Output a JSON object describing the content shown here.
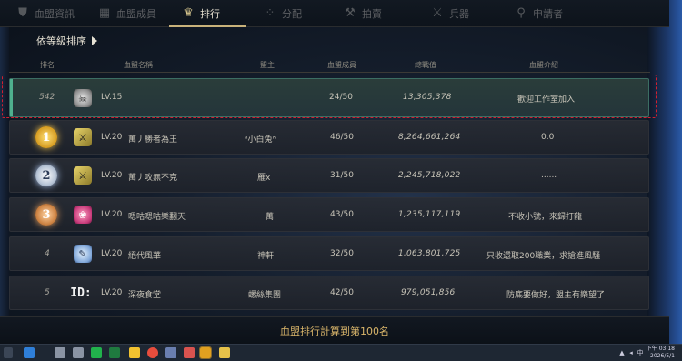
{
  "nav": {
    "tabs": [
      {
        "label": "血盟資訊",
        "icon": "shield-icon",
        "active": false
      },
      {
        "label": "血盟成員",
        "icon": "members-icon",
        "active": false
      },
      {
        "label": "排行",
        "icon": "ranking-icon",
        "active": true
      },
      {
        "label": "分配",
        "icon": "distribute-icon",
        "active": false
      },
      {
        "label": "拍賣",
        "icon": "gavel-icon",
        "active": false
      },
      {
        "label": "兵器",
        "icon": "weapon-icon",
        "active": false
      },
      {
        "label": "申請者",
        "icon": "applicant-icon",
        "active": false
      }
    ]
  },
  "sort_button": {
    "label": "依等級排序",
    "icon": "play-icon"
  },
  "table": {
    "headers": [
      "排名",
      "血盟名稱",
      "盟主",
      "血盟成員",
      "總戰值",
      "血盟介紹"
    ],
    "rows": [
      {
        "rank": "542",
        "rank_type": "number",
        "emblem": "skull-emblem-icon",
        "level": "LV.15",
        "name": "",
        "leader": "",
        "members": "24/50",
        "power": "13,305,378",
        "intro": "歡迎工作室加入",
        "highlighted": true
      },
      {
        "rank": "1",
        "rank_type": "gold",
        "emblem": "sword-emblem-icon",
        "level": "LV.20",
        "name": "萬丿勝者為王",
        "leader": "ᐢ小白兔ᐢ",
        "members": "46/50",
        "power": "8,264,661,264",
        "intro": "0.0",
        "highlighted": false
      },
      {
        "rank": "2",
        "rank_type": "silver",
        "emblem": "sword-emblem-icon",
        "level": "LV.20",
        "name": "萬丿攻無不克",
        "leader": "雁x",
        "members": "31/50",
        "power": "2,245,718,022",
        "intro": "......",
        "highlighted": false
      },
      {
        "rank": "3",
        "rank_type": "bronze",
        "emblem": "rose-emblem-icon",
        "level": "LV.20",
        "name": "嗯咕嗯咕樂翻天",
        "leader": "一萬",
        "members": "43/50",
        "power": "1,235,117,119",
        "intro": "不收小號，來歸打龍",
        "highlighted": false
      },
      {
        "rank": "4",
        "rank_type": "number",
        "emblem": "feather-emblem-icon",
        "level": "LV.20",
        "name": "絕代風華",
        "leader": "神軒",
        "members": "32/50",
        "power": "1,063,801,725",
        "intro": "只收還取200職業，求搶進風騷",
        "highlighted": false
      },
      {
        "rank": "5",
        "rank_type": "number",
        "emblem": "id-emblem-icon",
        "emblem_text": "ID:",
        "level": "LV.20",
        "name": "深夜食堂",
        "leader": "螺絲集團",
        "members": "42/50",
        "power": "979,051,856",
        "intro": "防底要做好，盟主有樂望了",
        "highlighted": false
      }
    ]
  },
  "footer_note": "血盟排行計算到第100名",
  "taskbar": {
    "time": "下午 03:18",
    "date": "2026/5/1",
    "lang": "中"
  },
  "colors": {
    "accent_gold": "#c9b27a",
    "highlight_row": "#24353a",
    "selection_dash": "#d02030",
    "footer_text": "#d9b56a"
  }
}
